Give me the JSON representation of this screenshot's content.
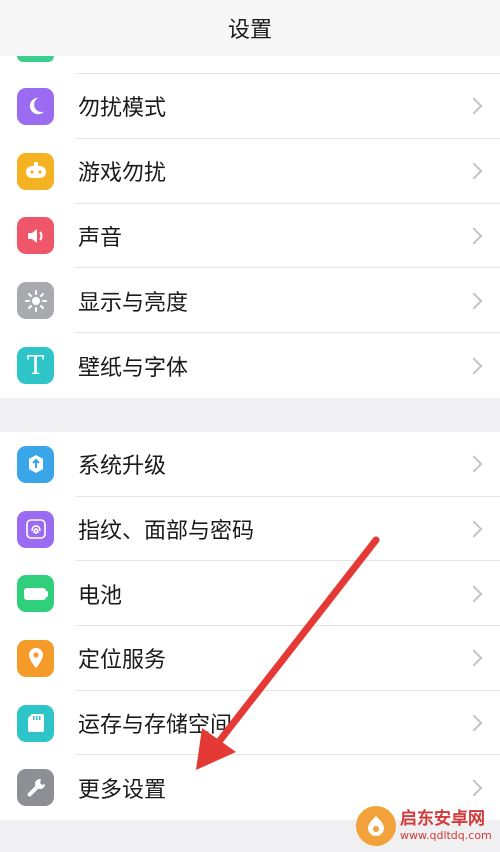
{
  "header": {
    "title": "设置"
  },
  "colors": {
    "arrow": "#e53935",
    "chevron": "#c4c4c6"
  },
  "group1": [
    {
      "label": "勿扰模式",
      "icon": "moon-icon",
      "color": "#9b6cf2"
    },
    {
      "label": "游戏勿扰",
      "icon": "gamepad-icon",
      "color": "#f5b324"
    },
    {
      "label": "声音",
      "icon": "speaker-icon",
      "color": "#f0566a"
    },
    {
      "label": "显示与亮度",
      "icon": "brightness-icon",
      "color": "#a9a9b0"
    },
    {
      "label": "壁纸与字体",
      "icon": "font-t-icon",
      "color": "#2ec5c9"
    }
  ],
  "group2": [
    {
      "label": "系统升级",
      "icon": "update-icon",
      "color": "#3aa6e8"
    },
    {
      "label": "指纹、面部与密码",
      "icon": "fingerprint-icon",
      "color": "#9b6cf2"
    },
    {
      "label": "电池",
      "icon": "battery-icon",
      "color": "#2fcf7b"
    },
    {
      "label": "定位服务",
      "icon": "location-pin-icon",
      "color": "#f59b2a"
    },
    {
      "label": "运存与存储空间",
      "icon": "sd-card-icon",
      "color": "#2ec5c9"
    },
    {
      "label": "更多设置",
      "icon": "wrench-icon",
      "color": "#8e8e95"
    }
  ],
  "watermark": {
    "name": "启东安卓网",
    "url": "www.qdltdq.com"
  }
}
